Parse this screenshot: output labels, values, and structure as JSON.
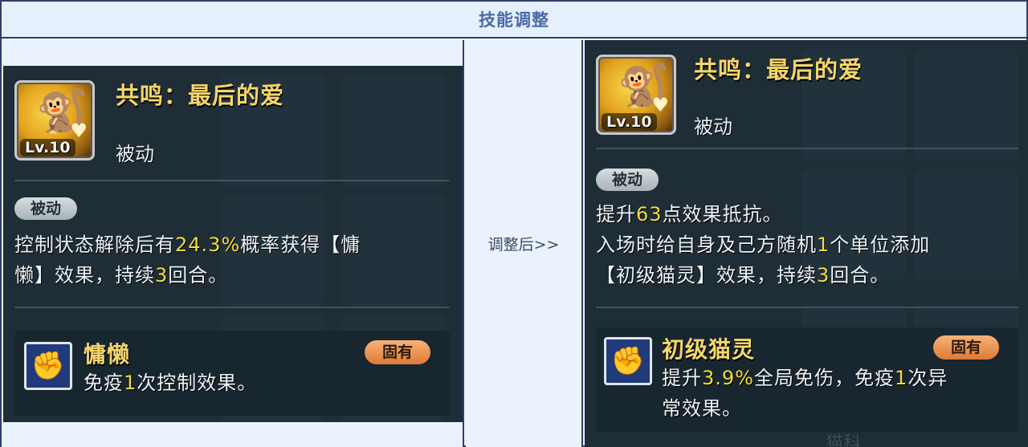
{
  "header": {
    "title": "技能调整"
  },
  "middle": {
    "label": "调整后>>"
  },
  "before": {
    "skill_name": "共鸣：最后的爱",
    "level": "Lv.10",
    "type_label": "被动",
    "pill_label": "被动",
    "desc_parts": [
      "控制状态解除后有",
      "24.3%",
      "概率获得【慵",
      "懒】效果，持续",
      "3",
      "回合。"
    ],
    "buff": {
      "name": "慵懒",
      "tag": "固有",
      "desc_parts": [
        "免疫",
        "1",
        "次控制效果。"
      ]
    }
  },
  "after": {
    "skill_name": "共鸣：最后的爱",
    "level": "Lv.10",
    "type_label": "被动",
    "pill_label": "被动",
    "desc_lines": [
      [
        "提升",
        "63",
        "点效果抵抗。"
      ],
      [
        "入场时给自身及己方随机",
        "1",
        "个单位添加"
      ],
      [
        "【初级猫灵】效果，持续",
        "3",
        "回合。"
      ]
    ],
    "buff": {
      "name": "初级猫灵",
      "tag": "固有",
      "desc_parts": [
        "提升",
        "3.9%",
        "全局免伤，免疫",
        "1",
        "次异",
        "常效果。"
      ]
    },
    "watermark": "猫科"
  },
  "colors": {
    "header_text": "#4a6aa8",
    "border": "#2e3f6e",
    "card_bg": "#1e2d36",
    "skill_name": "#f4d66a",
    "highlight": "#f2dd3a",
    "tag": "#e08a45"
  },
  "icons": {
    "skill": "monkey-figure-with-heart-icon",
    "buff": "muscle-figure-icon"
  }
}
